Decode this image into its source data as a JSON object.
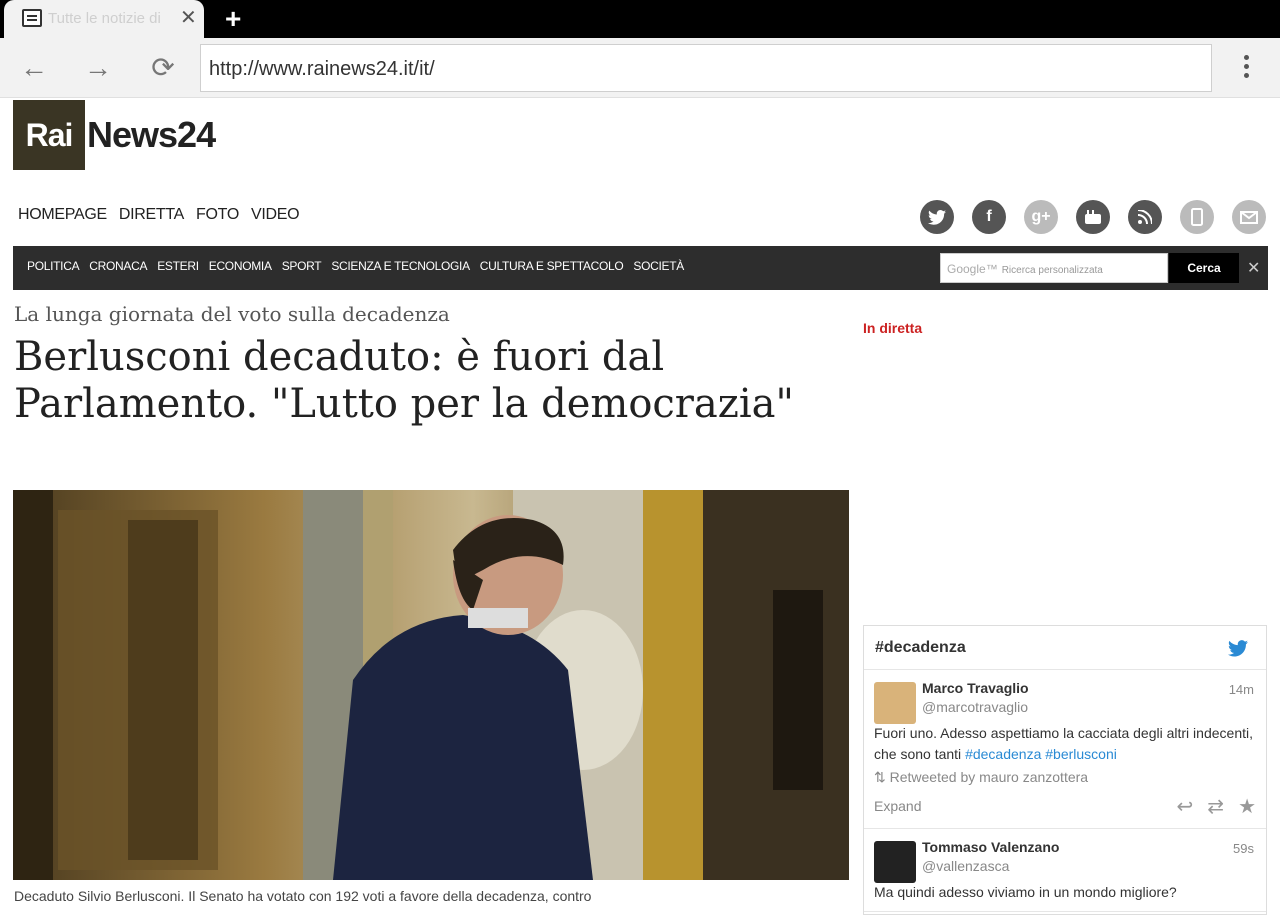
{
  "browser": {
    "tab_title": "Tutte le notizie di",
    "tab_close": "✕",
    "new_tab": "+",
    "back": "←",
    "forward": "→",
    "reload": "⟳",
    "url": "http://www.rainews24.it/it/"
  },
  "site": {
    "logo_rai": "Rai",
    "logo_rest": "News24",
    "top_nav": [
      "HOMEPAGE",
      "DIRETTA",
      "FOTO",
      "VIDEO"
    ],
    "categories": [
      "POLITICA",
      "CRONACA",
      "ESTERI",
      "ECONOMIA",
      "SPORT",
      "SCIENZA E TECNOLOGIA",
      "CULTURA E SPETTACOLO",
      "SOCIETÀ"
    ],
    "search_brand": "Google™",
    "search_placeholder": "Ricerca personalizzata",
    "search_button": "Cerca",
    "search_clear": "✕"
  },
  "social_icons": [
    "twitter-icon",
    "facebook-icon",
    "google-plus-icon",
    "youtube-icon",
    "rss-icon",
    "mobile-icon",
    "mail-icon"
  ],
  "article": {
    "kicker": "La lunga giornata del voto sulla decadenza",
    "headline": "Berlusconi decaduto: è fuori dal Parlamento. \"Lutto per la democrazia\"",
    "caption": "Decaduto Silvio Berlusconi. Il Senato ha votato con 192 voti a favore della decadenza, contro"
  },
  "sidebar": {
    "live_label": "In diretta"
  },
  "twitter": {
    "hashtag": "#decadenza",
    "tweets": [
      {
        "name": "Marco Travaglio",
        "handle": "@marcotravaglio",
        "time": "14m",
        "text": "Fuori uno. Adesso aspettiamo la cacciata degli altri indecenti, che sono tanti ",
        "tags": "#decadenza #berlusconi",
        "retweet": "Retweeted by mauro zanzottera",
        "expand": "Expand"
      },
      {
        "name": "Tommaso Valenzano",
        "handle": "@vallenzasca",
        "time": "59s",
        "text": "Ma quindi adesso viviamo in un mondo migliore?"
      }
    ]
  },
  "colors": {
    "accent_red": "#cc2222",
    "twitter_blue": "#2a8ad4",
    "catbar": "#2d2d2d"
  }
}
